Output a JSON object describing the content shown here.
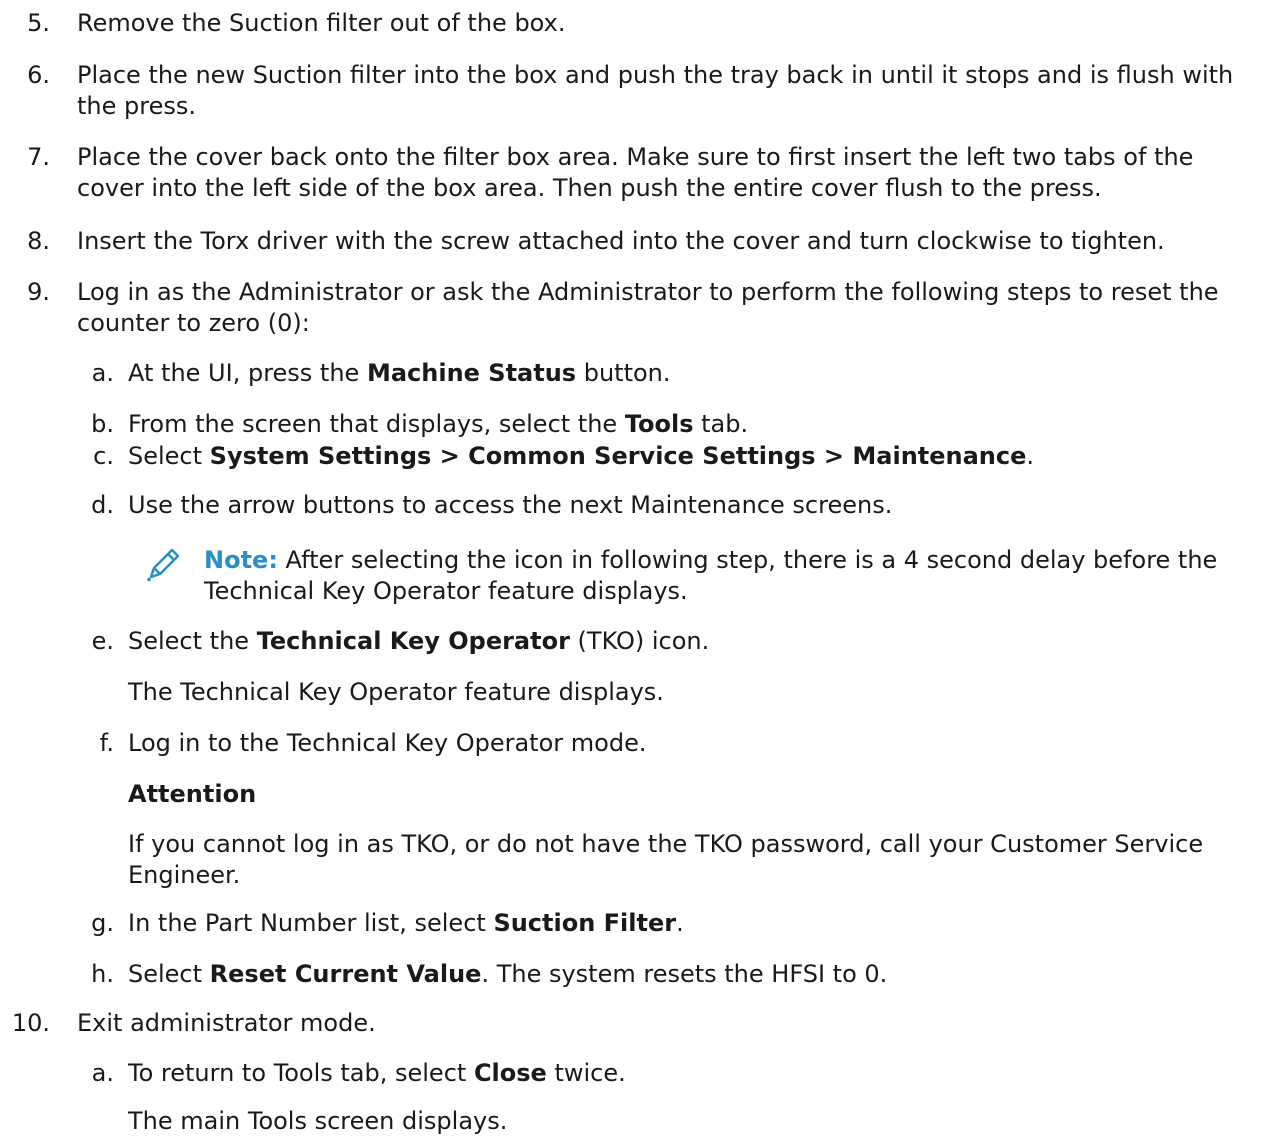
{
  "steps": [
    {
      "num": "5.",
      "text": "Remove the Suction filter out of the box."
    },
    {
      "num": "6.",
      "text": "Place the new Suction filter into the box and push the tray back in until it stops and is flush with the press."
    },
    {
      "num": "7.",
      "text": "Place the cover back onto the filter box area. Make sure to first insert the left two tabs of the cover into the left side of the box area. Then push the entire cover flush to the press."
    },
    {
      "num": "8.",
      "text": "Insert the Torx driver with the screw attached into the cover and turn clockwise to tighten."
    },
    {
      "num": "9.",
      "text": "Log in as the Administrator or ask the Administrator to perform the following steps to reset the counter to zero (0):"
    },
    {
      "num": "10.",
      "text": "Exit administrator mode."
    }
  ],
  "sub9": {
    "a": {
      "num": "a.",
      "pre": "At the UI, press the ",
      "bold": "Machine Status",
      "post": " button."
    },
    "b": {
      "num": "b.",
      "pre": "From the screen that displays, select the ",
      "bold": "Tools",
      "post": " tab."
    },
    "c": {
      "num": "c.",
      "pre": "Select ",
      "bold": "System Settings > Common Service Settings > Maintenance",
      "post": "."
    },
    "d": {
      "num": "d.",
      "text": "Use the arrow buttons to access the next Maintenance screens."
    },
    "e": {
      "num": "e.",
      "pre": "Select the ",
      "bold": "Technical Key Operator",
      "post": " (TKO) icon.",
      "result": "The Technical Key Operator feature displays."
    },
    "f": {
      "num": "f.",
      "text": "Log in to the Technical Key Operator mode.",
      "attention_title": "Attention",
      "attention_text": "If you cannot log in as TKO, or do not have the TKO password, call your Customer Service Engineer."
    },
    "g": {
      "num": "g.",
      "pre": "In the Part Number list, select ",
      "bold": "Suction Filter",
      "post": "."
    },
    "h": {
      "num": "h.",
      "pre": "Select ",
      "bold": "Reset Current Value",
      "post": ". The system resets the HFSI to 0."
    }
  },
  "note": {
    "icon": "pencil-icon",
    "label": "Note:",
    "text": " After selecting the icon in following step, there is a 4 second delay before the Technical Key Operator feature displays.",
    "color": "#2a8fc8"
  },
  "sub10": {
    "a": {
      "num": "a.",
      "pre": "To return to Tools tab, select ",
      "bold": "Close",
      "post": " twice.",
      "result": "The main Tools screen displays."
    }
  }
}
